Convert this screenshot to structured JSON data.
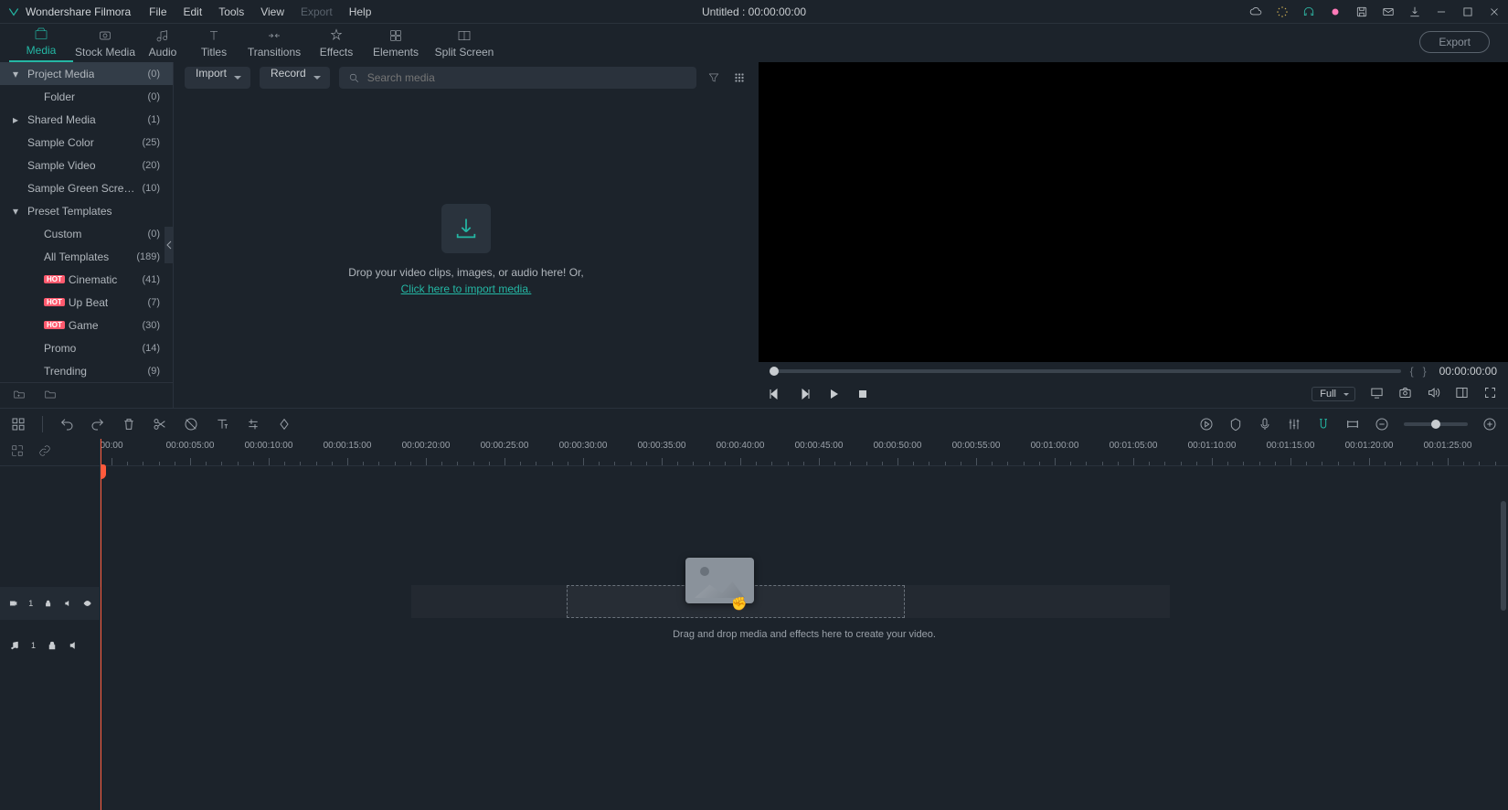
{
  "app": {
    "name": "Wondershare Filmora",
    "doc_title": "Untitled : 00:00:00:00"
  },
  "menu": {
    "file": "File",
    "edit": "Edit",
    "tools": "Tools",
    "view": "View",
    "export": "Export",
    "help": "Help"
  },
  "ribbon": {
    "tabs": [
      {
        "label": "Media"
      },
      {
        "label": "Stock Media"
      },
      {
        "label": "Audio"
      },
      {
        "label": "Titles"
      },
      {
        "label": "Transitions"
      },
      {
        "label": "Effects"
      },
      {
        "label": "Elements"
      },
      {
        "label": "Split Screen"
      }
    ],
    "export_btn": "Export"
  },
  "sidebar": {
    "items": [
      {
        "label": "Project Media",
        "count": "(0)",
        "arrow": "▾",
        "selected": true
      },
      {
        "label": "Folder",
        "count": "(0)",
        "child": true
      },
      {
        "label": "Shared Media",
        "count": "(1)",
        "arrow": "▸"
      },
      {
        "label": "Sample Color",
        "count": "(25)"
      },
      {
        "label": "Sample Video",
        "count": "(20)"
      },
      {
        "label": "Sample Green Scre…",
        "count": "(10)"
      },
      {
        "label": "Preset Templates",
        "arrow": "▾"
      },
      {
        "label": "Custom",
        "count": "(0)",
        "child": true
      },
      {
        "label": "All Templates",
        "count": "(189)",
        "child": true
      },
      {
        "label": "Cinematic",
        "count": "(41)",
        "child": true,
        "hot": true
      },
      {
        "label": "Up Beat",
        "count": "(7)",
        "child": true,
        "hot": true
      },
      {
        "label": "Game",
        "count": "(30)",
        "child": true,
        "hot": true
      },
      {
        "label": "Promo",
        "count": "(14)",
        "child": true
      },
      {
        "label": "Trending",
        "count": "(9)",
        "child": true
      }
    ],
    "hot_label": "HOT"
  },
  "media_toolbar": {
    "import": "Import",
    "record": "Record",
    "search_ph": "Search media"
  },
  "dropzone": {
    "line1": "Drop your video clips, images, or audio here! Or,",
    "link": "Click here to import media."
  },
  "preview": {
    "time": "00:00:00:00",
    "quality": "Full"
  },
  "timeline": {
    "ruler": [
      "00:00",
      "00:00:05:00",
      "00:00:10:00",
      "00:00:15:00",
      "00:00:20:00",
      "00:00:25:00",
      "00:00:30:00",
      "00:00:35:00",
      "00:00:40:00",
      "00:00:45:00",
      "00:00:50:00",
      "00:00:55:00",
      "00:01:00:00",
      "00:01:05:00",
      "00:01:10:00",
      "00:01:15:00",
      "00:01:20:00",
      "00:01:25:00"
    ],
    "hint": "Drag and drop media and effects here to create your video.",
    "track_video": "1",
    "track_audio": "1"
  }
}
